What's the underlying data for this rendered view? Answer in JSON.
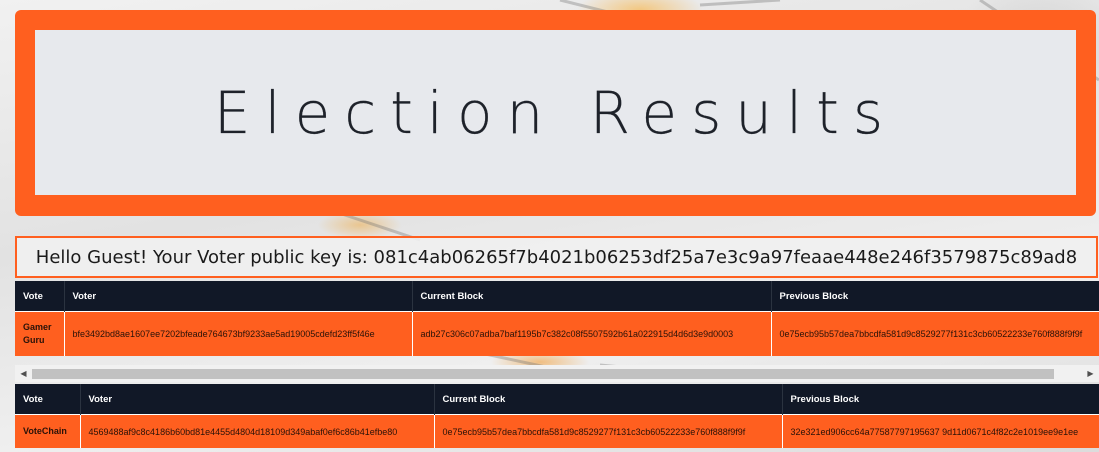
{
  "banner": {
    "title": "Election Results"
  },
  "greeting": {
    "text": "Hello Guest! Your Voter public key is: 081c4ab06265f7b4021b06253df25a7e3c9a97feaae448e246f3579875c89ad8"
  },
  "tables": [
    {
      "headers": [
        "Vote",
        "Voter",
        "Current Block",
        "Previous Block"
      ],
      "row": {
        "vote": "Gamer Guru",
        "voter": "bfe3492bd8ae1607ee7202bfeade764673bf9233ae5ad19005cdefd23ff5f46e",
        "current_block": "adb27c306c07adba7baf1195b7c382c08f5507592b61a022915d4d6d3e9d0003",
        "previous_block": "0e75ecb95b57dea7bbcdfa581d9c8529277f131c3cb60522233e760f888f9f9f"
      }
    },
    {
      "headers": [
        "Vote",
        "Voter",
        "Current Block",
        "Previous Block"
      ],
      "row": {
        "vote": "VoteChain",
        "voter": "4569488af9c8c4186b60bd81e4455d4804d18109d349abaf0ef6c86b41efbe80",
        "current_block": "0e75ecb95b57dea7bbcdfa581d9c8529277f131c3cb60522233e760f888f9f9f",
        "previous_block": "32e321ed906cc64a77587797195637 9d11d0671c4f82c2e1019ee9e1ee"
      }
    }
  ],
  "scrollbar": {
    "left_arrow": "◀",
    "right_arrow": "▶"
  }
}
